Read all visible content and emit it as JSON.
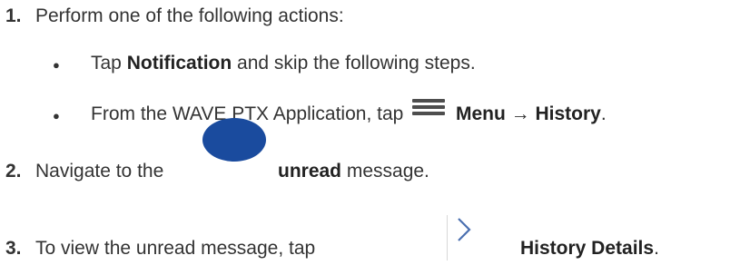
{
  "steps": {
    "s1": {
      "number": "1.",
      "text": "Perform one of the following actions:"
    },
    "s1a": {
      "prefix": "Tap ",
      "bold": "Notification",
      "suffix": " and skip the following steps."
    },
    "s1b": {
      "prefix": "From the WAVE PTX Application, tap",
      "bold1": "Menu",
      "arrow": " → ",
      "bold2": "History",
      "suffix": "."
    },
    "s2": {
      "number": "2.",
      "prefix": "Navigate to the",
      "bold": "unread",
      "suffix": " message."
    },
    "s3": {
      "number": "3.",
      "prefix": "To view the unread message, tap",
      "bold": "History Details",
      "suffix": "."
    }
  },
  "icons": {
    "menu": "hamburger-menu-icon",
    "unread": "unread-indicator-icon",
    "details": "chevron-right-icon"
  },
  "colors": {
    "unread_dot": "#1a4b9e",
    "text": "#333333"
  }
}
